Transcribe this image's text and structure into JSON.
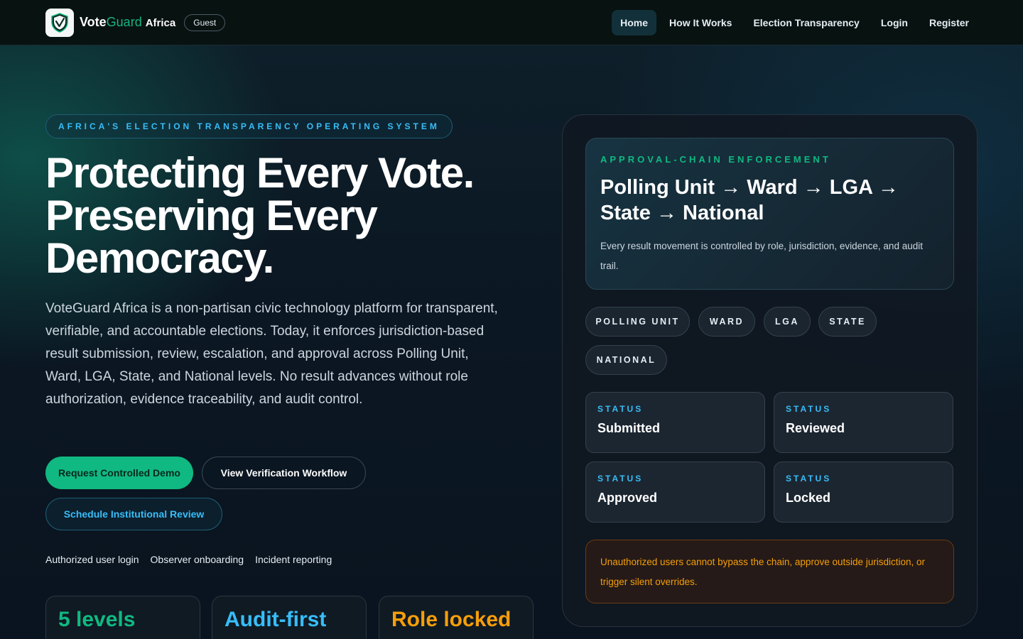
{
  "nav": {
    "brand_vote": "Vote",
    "brand_guard": "Guard",
    "brand_africa": "Africa",
    "guest_badge": "Guest",
    "links": [
      "Home",
      "How It Works",
      "Election Transparency",
      "Login",
      "Register"
    ],
    "active": "Home"
  },
  "hero": {
    "eyebrow": "AFRICA'S ELECTION TRANSPARENCY OPERATING SYSTEM",
    "title": "Protecting Every Vote. Preserving Every Democracy.",
    "description": "VoteGuard Africa is a non-partisan civic technology platform for transparent, verifiable, and accountable elections. Today, it enforces jurisdiction-based result submission, review, escalation, and approval across Polling Unit, Ward, LGA, State, and National levels. No result advances without role authorization, evidence traceability, and audit control.",
    "buttons": {
      "primary": "Request Controlled Demo",
      "secondary": "View Verification Workflow",
      "tertiary": "Schedule Institutional Review"
    },
    "quick_links": [
      "Authorized user login",
      "Observer onboarding",
      "Incident reporting"
    ],
    "stats": [
      {
        "label": "5 levels",
        "color": "#10b981"
      },
      {
        "label": "Audit-first",
        "color": "#38bdf8"
      },
      {
        "label": "Role locked",
        "color": "#f59e0b"
      }
    ]
  },
  "panel": {
    "eyebrow": "APPROVAL-CHAIN ENFORCEMENT",
    "title": "Polling Unit → Ward → LGA → State → National",
    "description": "Every result movement is controlled by role, jurisdiction, evidence, and audit trail.",
    "levels": [
      "POLLING UNIT",
      "WARD",
      "LGA",
      "STATE",
      "NATIONAL"
    ],
    "status_label": "STATUS",
    "statuses": [
      "Submitted",
      "Reviewed",
      "Approved",
      "Locked"
    ],
    "warning": "Unauthorized users cannot bypass the chain, approve outside jurisdiction, or trigger silent overrides."
  },
  "colors": {
    "accent_green": "#10b981",
    "accent_blue": "#38bdf8",
    "accent_amber": "#f59e0b"
  },
  "icons": {
    "logo": "shield-check-icon"
  }
}
